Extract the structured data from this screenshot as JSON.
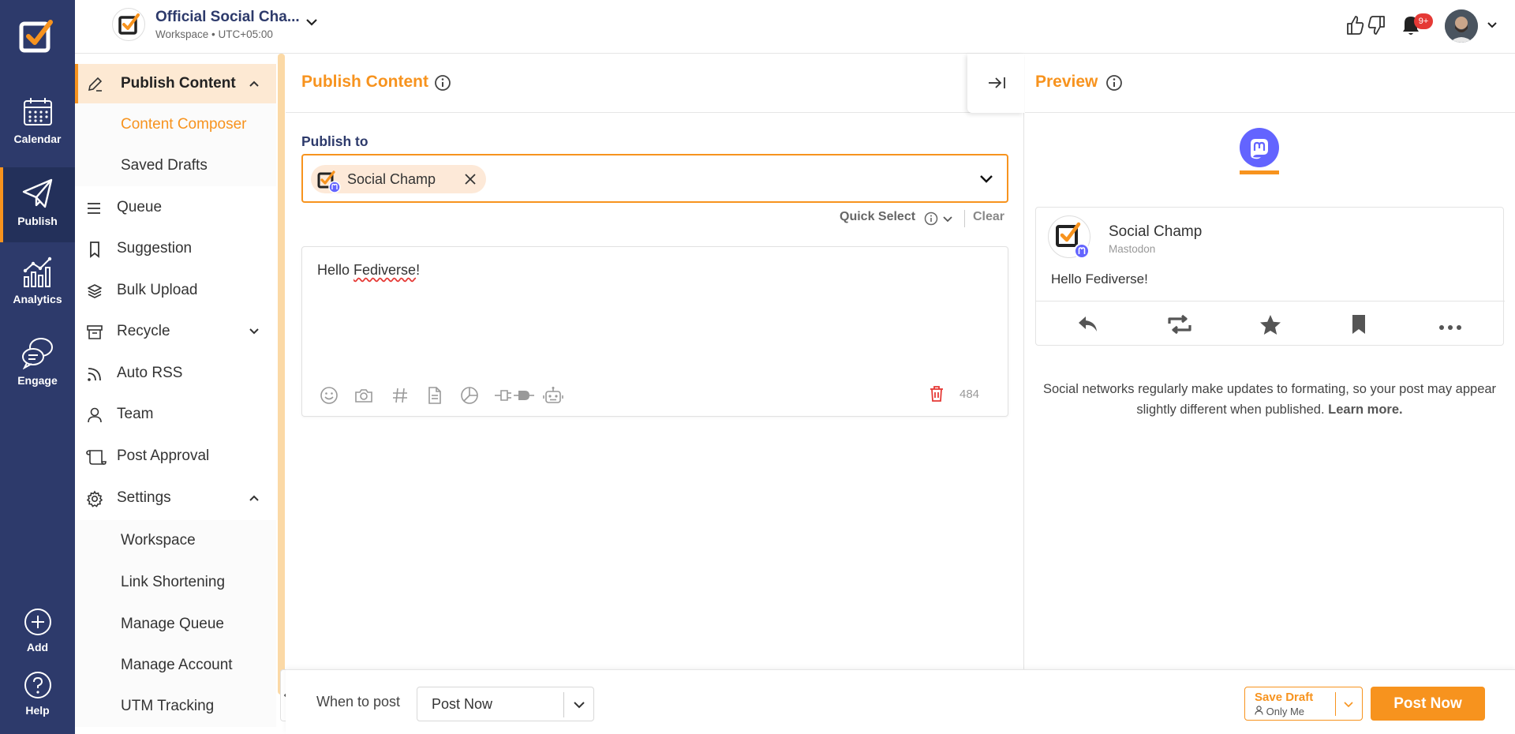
{
  "rail": {
    "items": [
      {
        "label": "Calendar",
        "icon": "calendar-icon"
      },
      {
        "label": "Publish",
        "icon": "paper-plane-icon"
      },
      {
        "label": "Analytics",
        "icon": "analytics-icon"
      },
      {
        "label": "Engage",
        "icon": "chat-bubbles-icon"
      },
      {
        "label": "Add",
        "icon": "plus-circle-icon"
      },
      {
        "label": "Help",
        "icon": "help-circle-icon"
      }
    ]
  },
  "header": {
    "workspace_name": "Official Social Cha...",
    "workspace_sub": "Workspace • UTC+05:00",
    "notification_badge": "9+"
  },
  "sidebar": {
    "publish_content": "Publish Content",
    "content_composer": "Content Composer",
    "saved_drafts": "Saved Drafts",
    "queue": "Queue",
    "suggestion": "Suggestion",
    "bulk_upload": "Bulk Upload",
    "recycle": "Recycle",
    "auto_rss": "Auto RSS",
    "team": "Team",
    "post_approval": "Post Approval",
    "settings": "Settings",
    "workspace": "Workspace",
    "link_shortening": "Link Shortening",
    "manage_queue": "Manage Queue",
    "manage_account": "Manage Account",
    "utm_tracking": "UTM Tracking"
  },
  "composer": {
    "title": "Publish Content",
    "publish_to_label": "Publish to",
    "chip_label": "Social Champ",
    "quick_select": "Quick Select",
    "clear": "Clear",
    "text_before": "Hello ",
    "text_misspelled": "Fediverse",
    "text_after": "!",
    "char_count": "484"
  },
  "preview": {
    "title": "Preview",
    "account_name": "Social Champ",
    "network": "Mastodon",
    "body": "Hello Fediverse!",
    "note": "Social networks regularly make updates to formating, so your post may appear slightly different when published.",
    "learn_more": "Learn more."
  },
  "bottom": {
    "when_to_post": "When to post",
    "when_value": "Post Now",
    "save_draft": "Save Draft",
    "save_draft_sub": "Only Me",
    "post_now": "Post Now"
  },
  "colors": {
    "accent": "#f7931e",
    "rail_bg": "#2d3a6b",
    "mastodon": "#6364ff",
    "badge": "#e53935"
  }
}
